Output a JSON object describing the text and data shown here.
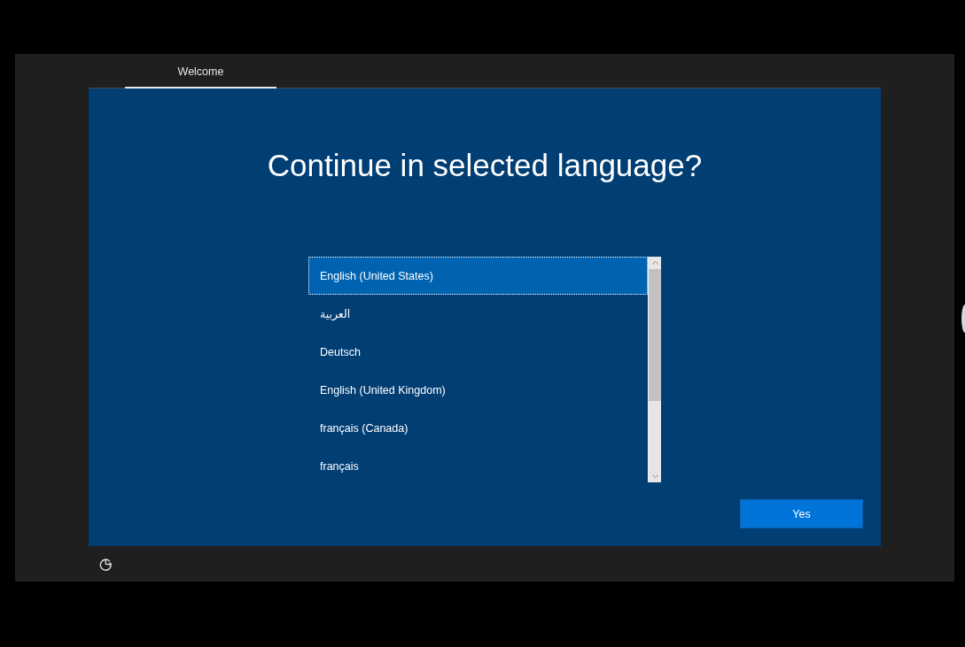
{
  "tabs": [
    {
      "label": "Welcome",
      "selected": true
    }
  ],
  "title": "Continue in selected language?",
  "languages": [
    {
      "label": "English (United States)",
      "selected": true
    },
    {
      "label": "العربية",
      "selected": false
    },
    {
      "label": "Deutsch",
      "selected": false
    },
    {
      "label": "English (United Kingdom)",
      "selected": false
    },
    {
      "label": "français (Canada)",
      "selected": false
    },
    {
      "label": "français",
      "selected": false
    }
  ],
  "buttons": [
    "Yes"
  ]
}
